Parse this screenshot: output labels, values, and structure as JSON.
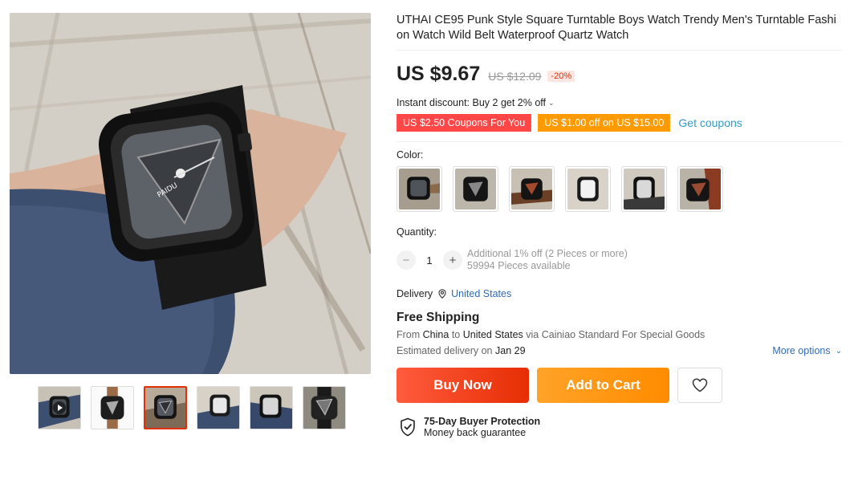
{
  "product": {
    "title": "UTHAI CE95 Punk Style Square Turntable Boys Watch Trendy Men's Turntable Fashion Watch Wild Belt Waterproof Quartz Watch",
    "price": "US $9.67",
    "original_price": "US $12.09",
    "discount": "-20%",
    "instant_discount": "Instant discount: Buy 2 get 2% off",
    "watch_brand_text": "PAIDU"
  },
  "coupons": {
    "coupon_1": "US $2.50 Coupons For You",
    "coupon_2": "US $1.00 off on US $15.00",
    "get_coupons": "Get coupons"
  },
  "color": {
    "label": "Color:",
    "swatches": [
      "black-tan",
      "black-grey",
      "brown-black",
      "white-black",
      "white-dark",
      "red-brown"
    ]
  },
  "quantity": {
    "label": "Quantity:",
    "minus": "−",
    "value": "1",
    "plus": "+",
    "additional": "Additional 1% off (2 Pieces or more)",
    "available": "59994 Pieces available"
  },
  "delivery": {
    "label": "Delivery",
    "country": "United States",
    "free_shipping": "Free Shipping",
    "from_prefix": "From",
    "from": "China",
    "to_prefix": "to",
    "to": "United States",
    "via": "via Cainiao Standard For Special Goods",
    "estimated_prefix": "Estimated delivery on",
    "estimated_date": "Jan 29",
    "more_options": "More options"
  },
  "actions": {
    "buy_now": "Buy Now",
    "add_to_cart": "Add to Cart"
  },
  "protection": {
    "title": "75-Day Buyer Protection",
    "subtitle": "Money back guarantee"
  },
  "colors": {
    "accent_red": "#e62e04",
    "coupon_red": "#ff4747",
    "coupon_orange": "#ff9a00",
    "link_blue": "#2e6bb7"
  },
  "icons": {
    "pin": "location-pin-icon",
    "heart": "heart-icon",
    "shield": "shield-check-icon",
    "play": "play-icon"
  }
}
